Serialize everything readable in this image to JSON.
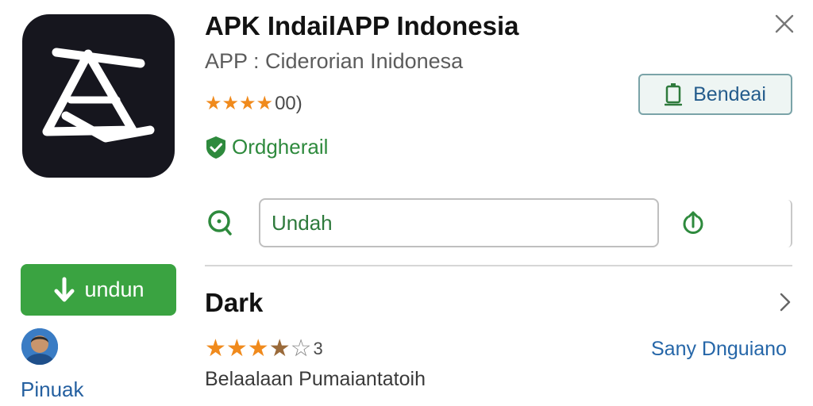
{
  "app": {
    "title": "APK IndailAPP Indonesia",
    "subtitle": "APP : Ciderorian Inidonesa",
    "rating_stars": "★★★★",
    "rating_count": "00)",
    "verified_label": "Ordgherail",
    "icon": "app-logo-a-icon"
  },
  "actions": {
    "bendeai_label": "Bendeai",
    "search_value": "Undah",
    "unduh_label": "undun"
  },
  "profile": {
    "name": "Pinuak"
  },
  "section": {
    "title": "Dark",
    "review_stars_full": "★★★",
    "review_star_partial": "★",
    "review_star_empty": "☆",
    "review_count": "3",
    "developer_link": "Sany Dnguiano",
    "description": "Belaalaan Pumaiantatoih"
  },
  "colors": {
    "accent_green": "#3aa341",
    "star_orange": "#f08a1c",
    "link_blue": "#2566a8"
  }
}
